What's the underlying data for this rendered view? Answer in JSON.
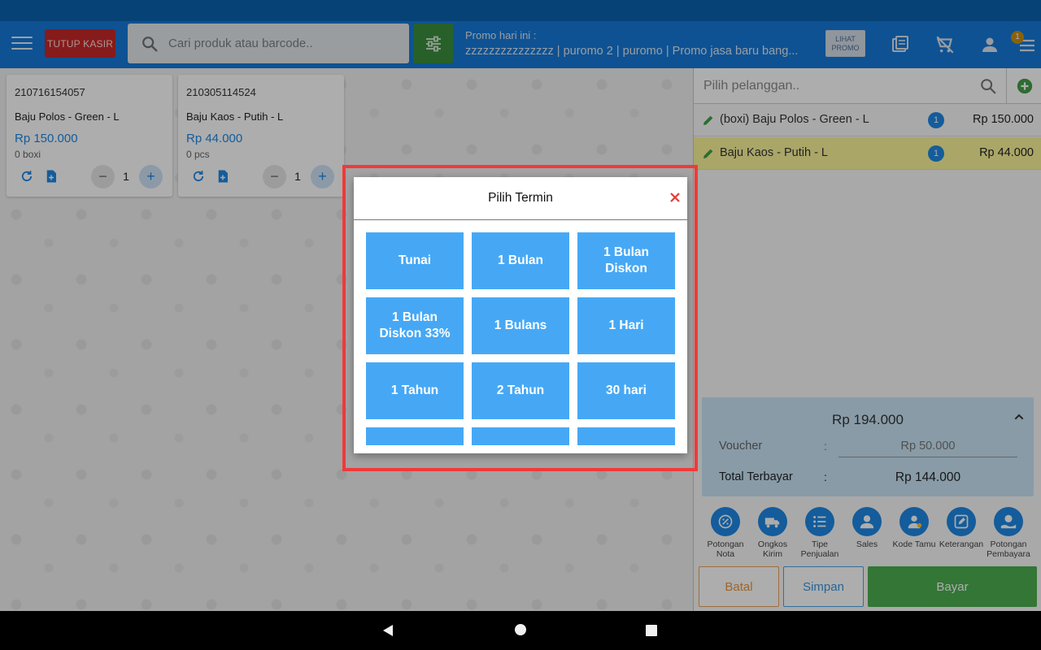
{
  "header": {
    "tutup_kasir_label": "TUTUP KASIR",
    "search_placeholder": "Cari produk atau barcode..",
    "promo_label": "Promo hari ini :",
    "promo_text": "zzzzzzzzzzzzzzz | puromo 2 | puromo | Promo jasa baru bang...",
    "lihat_promo_line1": "LIHAT",
    "lihat_promo_line2": "PROMO",
    "notification_count": "1"
  },
  "products": [
    {
      "code": "210716154057",
      "name": "Baju Polos - Green - L",
      "price": "Rp 150.000",
      "stock": "0 boxi",
      "qty": "1"
    },
    {
      "code": "210305114524",
      "name": "Baju Kaos - Putih - L",
      "price": "Rp 44.000",
      "stock": "0 pcs",
      "qty": "1"
    }
  ],
  "customer": {
    "placeholder": "Pilih pelanggan.."
  },
  "cart": [
    {
      "name": "(boxi) Baju Polos - Green - L",
      "qty": "1",
      "price": "Rp 150.000"
    },
    {
      "name": "Baju Kaos - Putih - L",
      "qty": "1",
      "price": "Rp 44.000"
    }
  ],
  "summary": {
    "subtotal": "Rp 194.000",
    "voucher_label": "Voucher",
    "voucher_value": "Rp 50.000",
    "total_label": "Total Terbayar",
    "total_value": "Rp 144.000",
    "colon": ":"
  },
  "actions": [
    {
      "label": "Potongan Nota",
      "icon": "discount-icon"
    },
    {
      "label": "Ongkos Kirim",
      "icon": "truck-icon"
    },
    {
      "label": "Tipe Penjualan",
      "icon": "list-icon"
    },
    {
      "label": "Sales",
      "icon": "person-icon"
    },
    {
      "label": "Kode Tamu",
      "icon": "guest-icon"
    },
    {
      "label": "Keterangan",
      "icon": "edit-note-icon"
    },
    {
      "label": "Potongan Pembayara",
      "icon": "payment-discount-icon"
    }
  ],
  "buttons": {
    "batal": "Batal",
    "simpan": "Simpan",
    "bayar": "Bayar"
  },
  "dialog": {
    "title": "Pilih Termin",
    "terms": [
      "Tunai",
      "1 Bulan",
      "1 Bulan Diskon",
      "1 Bulan Diskon 33%",
      "1 Bulans",
      "1 Hari",
      "1 Tahun",
      "2 Tahun",
      "30 hari",
      "",
      "",
      ""
    ]
  },
  "colors": {
    "appbar": "#1579d9",
    "accent": "#1e88e5",
    "term_button": "#46a8f5",
    "highlight": "#f03a3a",
    "bayar": "#4caf50"
  }
}
